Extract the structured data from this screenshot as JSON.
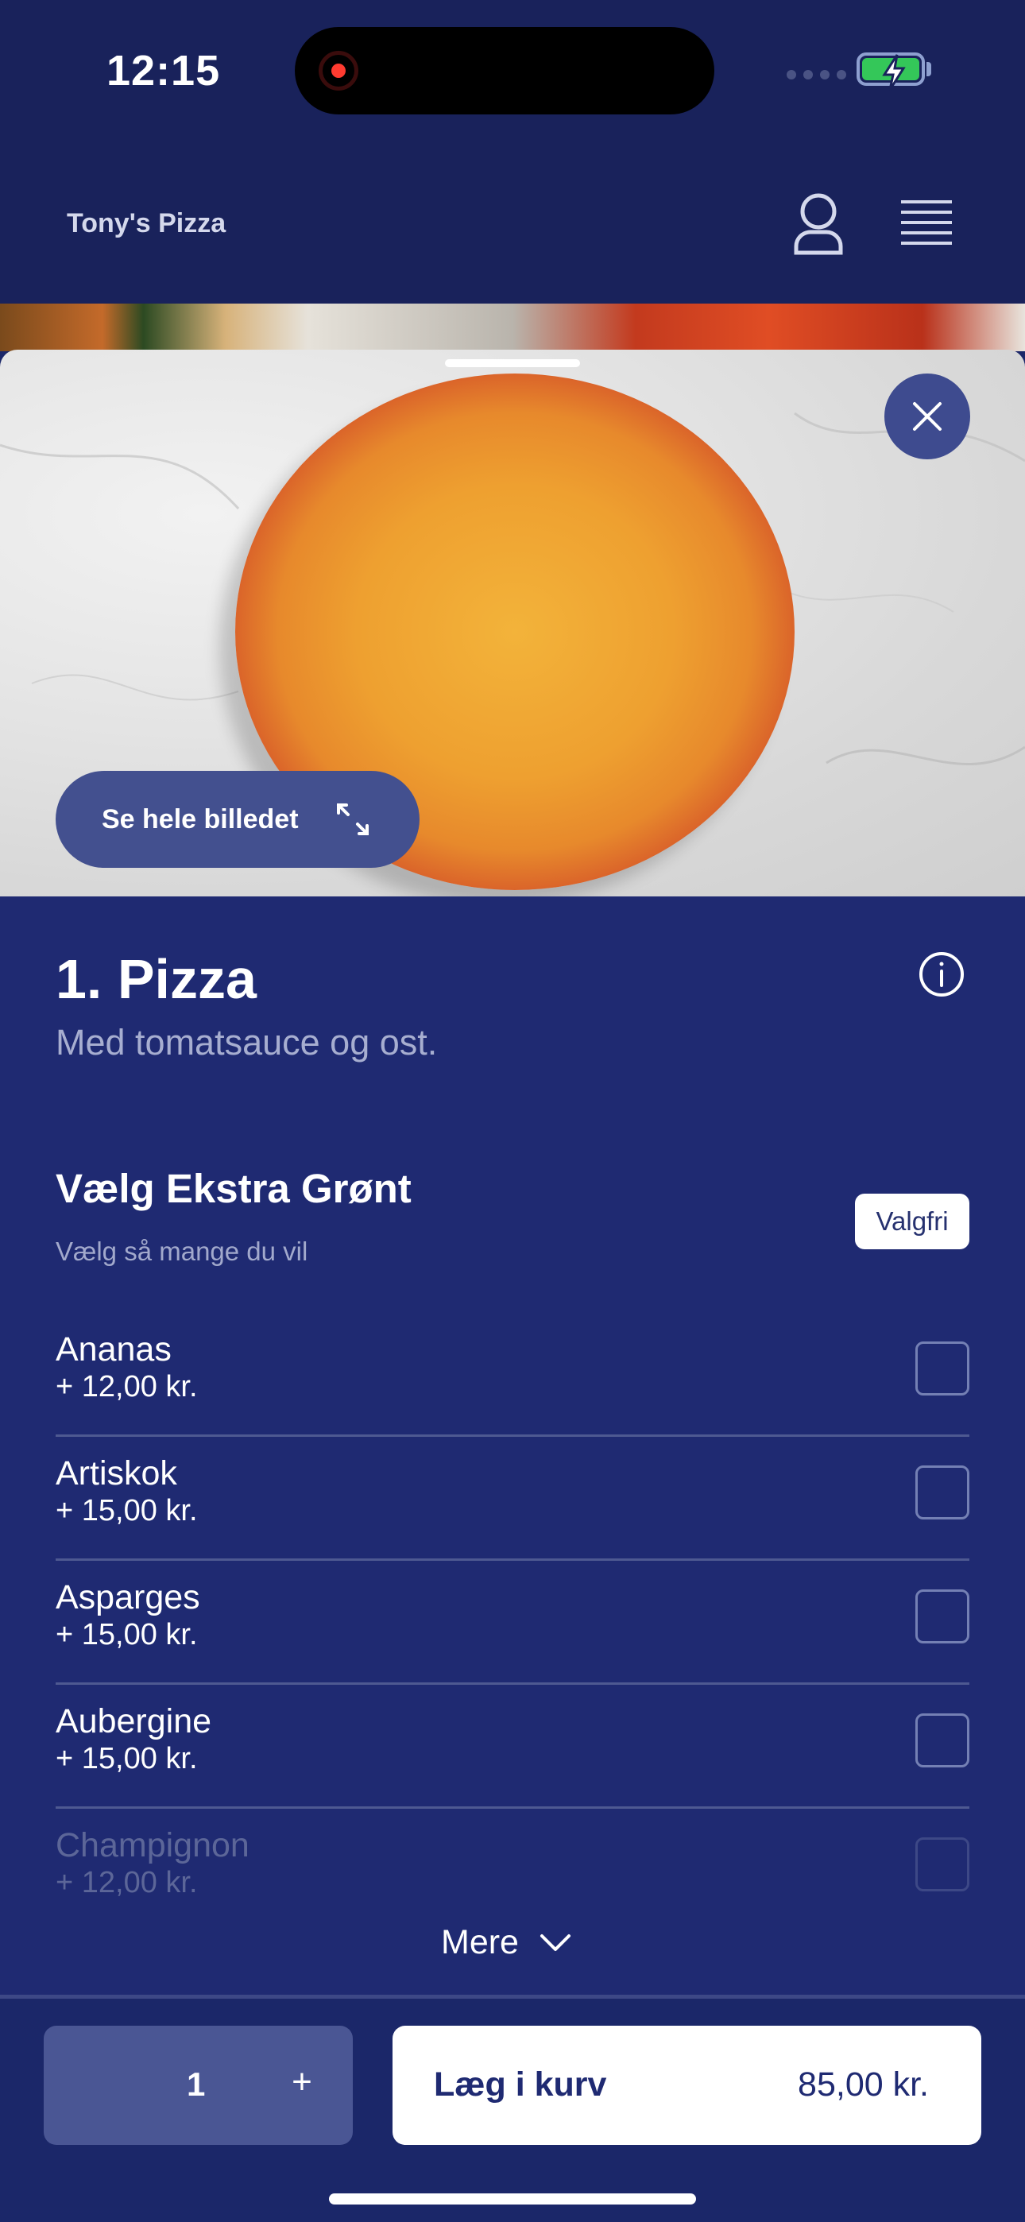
{
  "status_bar": {
    "time": "12:15"
  },
  "header": {
    "brand": "Tony's Pizza"
  },
  "hero": {
    "see_image_label": "Se hele billedet"
  },
  "product": {
    "title": "1. Pizza",
    "description": "Med tomatsauce og ost."
  },
  "section": {
    "title": "Vælg Ekstra Grønt",
    "subtitle": "Vælg så mange du vil",
    "badge": "Valgfri"
  },
  "options": [
    {
      "name": "Ananas",
      "price": "+ 12,00 kr."
    },
    {
      "name": "Artiskok",
      "price": "+ 15,00 kr."
    },
    {
      "name": "Asparges",
      "price": "+ 15,00 kr."
    },
    {
      "name": "Aubergine",
      "price": "+ 15,00 kr."
    },
    {
      "name": "Champignon",
      "price": "+ 12,00 kr."
    }
  ],
  "more_label": "Mere",
  "footer": {
    "quantity": "1",
    "plus": "+",
    "cart_label": "Læg i kurv",
    "cart_price": "85,00 kr."
  },
  "colors": {
    "background": "#1f2a72",
    "header": "#19225b",
    "accent_button": "#43508f",
    "battery": "#34c759",
    "record": "#ff3b30"
  },
  "icons": [
    "record-icon",
    "battery-icon",
    "user-icon",
    "menu-icon",
    "close-icon",
    "expand-icon",
    "info-icon",
    "chevron-down-icon"
  ]
}
